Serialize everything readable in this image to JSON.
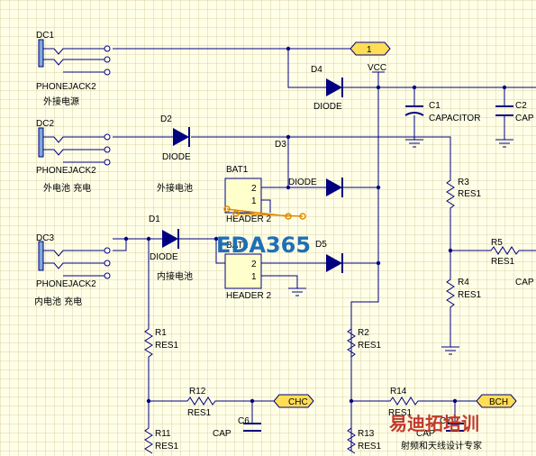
{
  "colors": {
    "background": "#ffffe8",
    "grid": "#d8d2a8",
    "wire": "#000080",
    "component": "#000080",
    "port_fill": "#ffdd55",
    "watermark_blue": "#1e6fb5",
    "watermark_red": "#c0392b"
  },
  "jacks": [
    {
      "ref": "DC1",
      "part": "PHONEJACK2",
      "note": "外接电源"
    },
    {
      "ref": "DC2",
      "part": "PHONEJACK2",
      "note": "外电池 充电"
    },
    {
      "ref": "DC3",
      "part": "PHONEJACK2",
      "note": "内电池 充电"
    }
  ],
  "ports": {
    "p1": "1",
    "chc": "CHC",
    "bch": "BCH"
  },
  "vcc": "VCC",
  "diodes": {
    "d1": {
      "ref": "D1",
      "value": "DIODE"
    },
    "d2": {
      "ref": "D2",
      "value": "DIODE"
    },
    "d3": {
      "ref": "D3",
      "value": "DIODE"
    },
    "d4": {
      "ref": "D4",
      "value": "DIODE"
    },
    "d5": {
      "ref": "D5",
      "value": ""
    }
  },
  "capacitors": {
    "c1": {
      "ref": "C1",
      "value": "CAPACITOR"
    },
    "c2": {
      "ref": "C2",
      "value": "CAP"
    },
    "c6": {
      "ref": "C6",
      "value": "CAP"
    },
    "c7": {
      "ref": "C7",
      "value": "CAP"
    },
    "c5cap": {
      "value": "CAP"
    }
  },
  "resistors": {
    "r1": {
      "ref": "R1",
      "value": "RES1"
    },
    "r2": {
      "ref": "R2",
      "value": "RES1"
    },
    "r3": {
      "ref": "R3",
      "value": "RES1"
    },
    "r4": {
      "ref": "R4",
      "value": "RES1"
    },
    "r5": {
      "ref": "R5",
      "value": "RES1"
    },
    "r11": {
      "ref": "R11",
      "value": "RES1"
    },
    "r12": {
      "ref": "R12",
      "value": "RES1"
    },
    "r13": {
      "ref": "R13",
      "value": "RES1"
    },
    "r14": {
      "ref": "R14",
      "value": "RES1"
    }
  },
  "headers": {
    "bat1": {
      "ref": "BAT1",
      "part": "HEADER 2",
      "note": "外接电池",
      "pins": [
        "2",
        "1"
      ]
    },
    "bat2": {
      "ref": "BAT2",
      "part": "HEADER 2",
      "note": "内接电池",
      "pins": [
        "2",
        "1"
      ]
    }
  },
  "watermarks": {
    "eda": "EDA365",
    "school_name": "易迪拓培训",
    "school_tagline": "射频和天线设计专家"
  }
}
